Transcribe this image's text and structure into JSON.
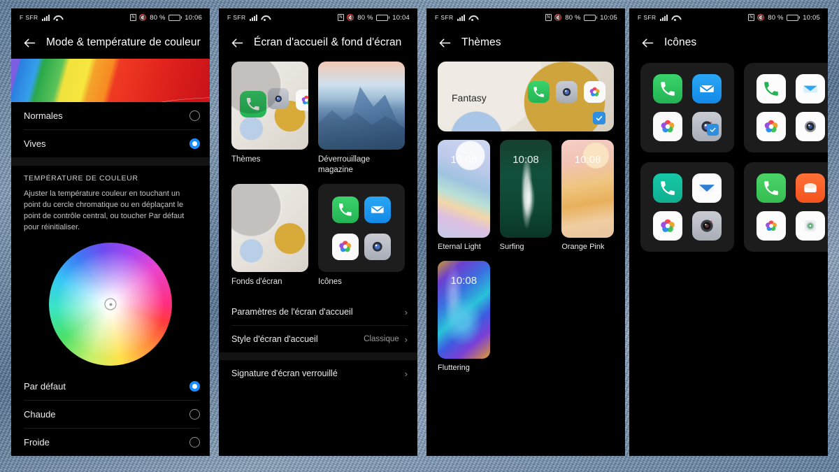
{
  "background": {
    "style": "denim-fabric-texture",
    "color": "#6f8fb0"
  },
  "panels": [
    {
      "id": "panel-color-mode",
      "statusbar": {
        "carrier": "F SFR",
        "battery_pct": "80 %",
        "time": "10:06",
        "icons": [
          "signal-bars-icon",
          "wifi-icon",
          "nfc-icon",
          "mute-icon",
          "battery-icon"
        ]
      },
      "title": "Mode & température de couleur",
      "banner": "rainbow-gradient-preview",
      "modes": [
        {
          "label": "Normales",
          "selected": false
        },
        {
          "label": "Vives",
          "selected": true
        }
      ],
      "section": {
        "heading": "TEMPÉRATURE DE COULEUR",
        "description": "Ajuster la température couleur en touchant un point du cercle chromatique ou en déplaçant le point de contrôle central, ou toucher Par défaut pour réinitialiser."
      },
      "temperatures": [
        {
          "label": "Par défaut",
          "selected": true
        },
        {
          "label": "Chaude",
          "selected": false
        },
        {
          "label": "Froide",
          "selected": false
        }
      ]
    },
    {
      "id": "panel-home-screen",
      "statusbar": {
        "carrier": "F SFR",
        "battery_pct": "80 %",
        "time": "10:04"
      },
      "title": "Écran d'accueil & fond d'écran",
      "tiles": [
        {
          "label": "Thèmes",
          "thumb": "balls-wallpaper-with-icons"
        },
        {
          "label": "Déverrouillage magazine",
          "thumb": "mountain-photo"
        },
        {
          "label": "Fonds d'écran",
          "thumb": "balls-wallpaper"
        },
        {
          "label": "Icônes",
          "thumb": "icon-pack-preview"
        }
      ],
      "rows": [
        {
          "label": "Paramètres de l'écran d'accueil",
          "value": "",
          "chevron": "›"
        },
        {
          "label": "Style d'écran d'accueil",
          "value": "Classique",
          "chevron": "›"
        },
        {
          "label": "Signature d'écran verrouillé",
          "value": "",
          "chevron": "›"
        }
      ]
    },
    {
      "id": "panel-themes",
      "statusbar": {
        "carrier": "F SFR",
        "battery_pct": "80 %",
        "time": "10:05"
      },
      "title": "Thèmes",
      "hero": {
        "name": "Fantasy",
        "selected": true
      },
      "themes": [
        {
          "label": "Eternal Light",
          "time": "10:08"
        },
        {
          "label": "Surfing",
          "time": "10:08"
        },
        {
          "label": "Orange Pink",
          "time": "10:08"
        },
        {
          "label": "Fluttering",
          "time": "10:08"
        }
      ]
    },
    {
      "id": "panel-icons",
      "statusbar": {
        "carrier": "F SFR",
        "battery_pct": "80 %",
        "time": "10:05"
      },
      "title": "Icônes",
      "packs": [
        {
          "name": "pack-1",
          "selected": true,
          "icons": [
            "phone-icon",
            "message-icon",
            "gallery-icon",
            "camera-icon"
          ]
        },
        {
          "name": "pack-2",
          "selected": false,
          "icons": [
            "phone-icon",
            "message-icon",
            "gallery-icon",
            "camera-icon"
          ]
        },
        {
          "name": "pack-3",
          "selected": false,
          "icons": [
            "phone-icon",
            "mail-icon",
            "gallery-icon",
            "camera-icon"
          ]
        },
        {
          "name": "pack-4",
          "selected": false,
          "icons": [
            "phone-icon",
            "mail-icon",
            "gallery-icon",
            "camera-icon"
          ]
        }
      ]
    }
  ],
  "accent": {
    "blue": "#1a8cff",
    "check_blue": "#2e8fe0"
  }
}
